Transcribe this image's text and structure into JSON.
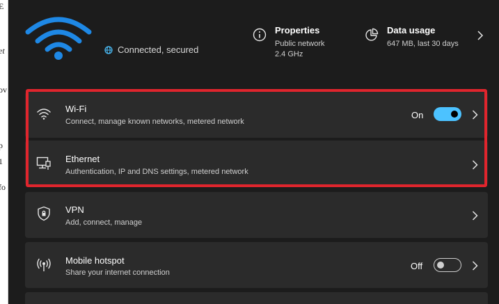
{
  "left_strip": {
    "fragments": [
      "E",
      "et",
      "ov",
      "p",
      "1",
      "fo"
    ]
  },
  "header": {
    "connection_status": "Connected, secured",
    "properties": {
      "title": "Properties",
      "line1": "Public network",
      "line2": "2.4 GHz"
    },
    "data_usage": {
      "title": "Data usage",
      "line1": "647 MB, last 30 days"
    }
  },
  "items": {
    "wifi": {
      "title": "Wi-Fi",
      "subtitle": "Connect, manage known networks, metered network",
      "toggle_label": "On",
      "toggle_state": true
    },
    "ethernet": {
      "title": "Ethernet",
      "subtitle": "Authentication, IP and DNS settings, metered network"
    },
    "vpn": {
      "title": "VPN",
      "subtitle": "Add, connect, manage"
    },
    "hotspot": {
      "title": "Mobile hotspot",
      "subtitle": "Share your internet connection",
      "toggle_label": "Off",
      "toggle_state": false
    }
  },
  "colors": {
    "accent": "#4cc2ff",
    "wifi_icon": "#1e88e5",
    "highlight_border": "#e0252d",
    "card_bg": "#2b2b2b",
    "page_bg": "#1c1c1c"
  }
}
